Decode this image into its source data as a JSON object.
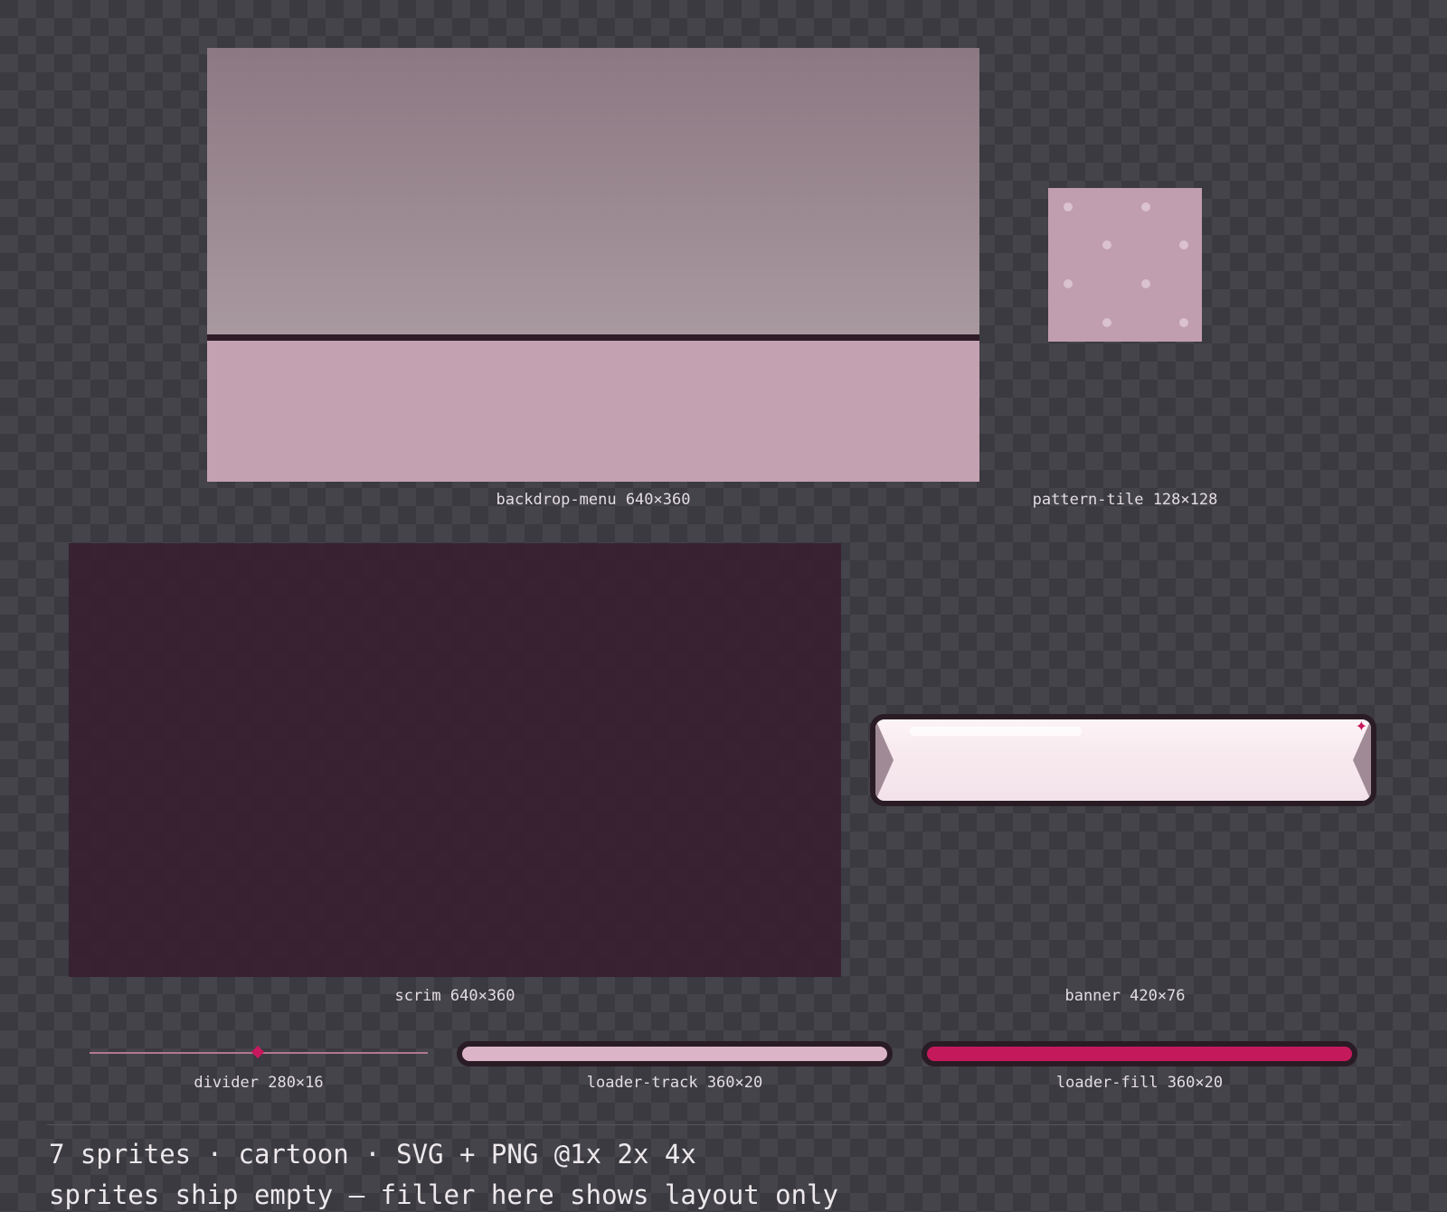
{
  "sprites": [
    {
      "id": "backdrop-menu",
      "label": "backdrop-menu 640×360"
    },
    {
      "id": "pattern-tile",
      "label": "pattern-tile 128×128"
    },
    {
      "id": "scrim",
      "label": "scrim 640×360"
    },
    {
      "id": "banner",
      "label": "banner 420×76"
    },
    {
      "id": "divider",
      "label": "divider 280×16"
    },
    {
      "id": "loader-track",
      "label": "loader-track 360×20"
    },
    {
      "id": "loader-fill",
      "label": "loader-fill 360×20"
    }
  ],
  "footer": {
    "line1": "7 sprites · cartoon · SVG + PNG @1x 2x 4x",
    "line2": "sprites ship empty — filler here shows layout only"
  },
  "colors": {
    "accent": "#c41a5c",
    "pink_light": "#c3a1b0",
    "outline": "#2a1c24",
    "background_checker_dark": "#3a3a40",
    "background_checker_light": "#44444a"
  },
  "icons": {
    "banner_corner": "sparkle-icon",
    "divider_center": "diamond-icon"
  }
}
